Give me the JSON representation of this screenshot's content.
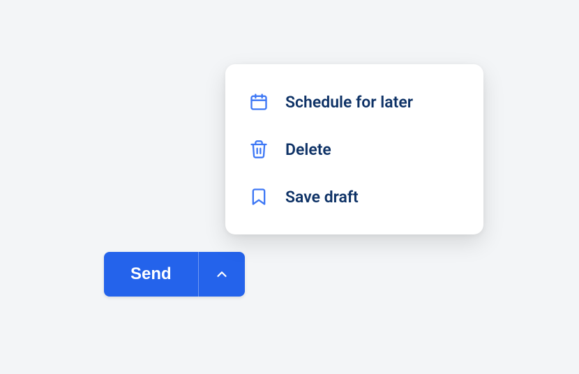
{
  "button": {
    "primary_label": "Send"
  },
  "menu": {
    "items": [
      {
        "label": "Schedule for later",
        "icon": "calendar"
      },
      {
        "label": "Delete",
        "icon": "trash"
      },
      {
        "label": "Save draft",
        "icon": "bookmark"
      }
    ]
  },
  "colors": {
    "primary": "#2463eb",
    "menu_text": "#0e3266",
    "icon": "#3d77f5",
    "background": "#f3f5f7"
  }
}
